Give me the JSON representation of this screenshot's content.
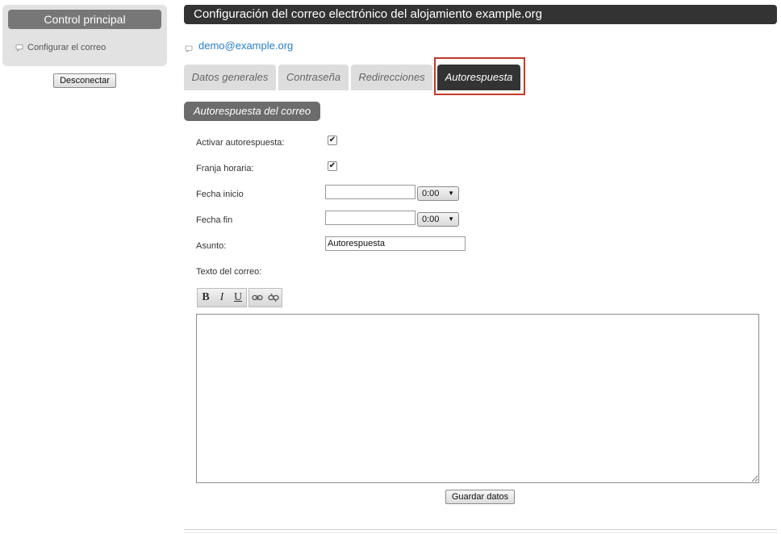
{
  "sidebar": {
    "title": "Control principal",
    "items": [
      {
        "label": "Configurar el correo",
        "icon": "speech-bubble-icon"
      }
    ],
    "logout_label": "Desconectar"
  },
  "header": {
    "title": "Configuración del correo electrónico del alojamiento example.org"
  },
  "account": {
    "email": "demo@example.org",
    "icon": "mail-bubble-icon"
  },
  "tabs": [
    {
      "label": "Datos generales",
      "active": false
    },
    {
      "label": "Contraseña",
      "active": false
    },
    {
      "label": "Redirecciones",
      "active": false
    },
    {
      "label": "Autorespuesta",
      "active": true
    }
  ],
  "section": {
    "title": "Autorespuesta del correo"
  },
  "form": {
    "activate_label": "Activar autorespuesta:",
    "activate_checked": true,
    "timeframe_label": "Franja horaria:",
    "timeframe_checked": true,
    "start_label": "Fecha inicio",
    "start_date": "",
    "start_time": "0:00",
    "end_label": "Fecha fin",
    "end_date": "",
    "end_time": "0:00",
    "subject_label": "Asunto:",
    "subject_value": "Autorespuesta",
    "body_label": "Texto del correo:",
    "body_value": ""
  },
  "editor": {
    "tools": [
      {
        "label": "B",
        "name": "bold"
      },
      {
        "label": "I",
        "name": "italic"
      },
      {
        "label": "U",
        "name": "underline"
      }
    ],
    "link_tools": [
      "link-icon",
      "unlink-icon"
    ]
  },
  "save_label": "Guardar datos",
  "colors": {
    "highlight": "#c0392b",
    "link": "#2a7fc0",
    "header_bg": "#333333"
  }
}
